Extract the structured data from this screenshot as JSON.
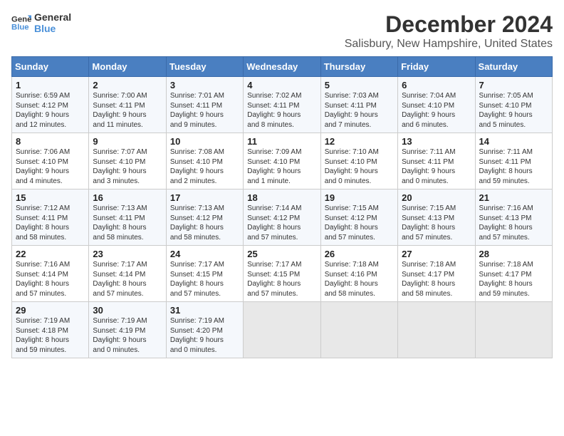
{
  "logo": {
    "line1": "General",
    "line2": "Blue"
  },
  "title": "December 2024",
  "subtitle": "Salisbury, New Hampshire, United States",
  "days_of_week": [
    "Sunday",
    "Monday",
    "Tuesday",
    "Wednesday",
    "Thursday",
    "Friday",
    "Saturday"
  ],
  "weeks": [
    [
      {
        "day": "1",
        "info": "Sunrise: 6:59 AM\nSunset: 4:12 PM\nDaylight: 9 hours\nand 12 minutes."
      },
      {
        "day": "2",
        "info": "Sunrise: 7:00 AM\nSunset: 4:11 PM\nDaylight: 9 hours\nand 11 minutes."
      },
      {
        "day": "3",
        "info": "Sunrise: 7:01 AM\nSunset: 4:11 PM\nDaylight: 9 hours\nand 9 minutes."
      },
      {
        "day": "4",
        "info": "Sunrise: 7:02 AM\nSunset: 4:11 PM\nDaylight: 9 hours\nand 8 minutes."
      },
      {
        "day": "5",
        "info": "Sunrise: 7:03 AM\nSunset: 4:11 PM\nDaylight: 9 hours\nand 7 minutes."
      },
      {
        "day": "6",
        "info": "Sunrise: 7:04 AM\nSunset: 4:10 PM\nDaylight: 9 hours\nand 6 minutes."
      },
      {
        "day": "7",
        "info": "Sunrise: 7:05 AM\nSunset: 4:10 PM\nDaylight: 9 hours\nand 5 minutes."
      }
    ],
    [
      {
        "day": "8",
        "info": "Sunrise: 7:06 AM\nSunset: 4:10 PM\nDaylight: 9 hours\nand 4 minutes."
      },
      {
        "day": "9",
        "info": "Sunrise: 7:07 AM\nSunset: 4:10 PM\nDaylight: 9 hours\nand 3 minutes."
      },
      {
        "day": "10",
        "info": "Sunrise: 7:08 AM\nSunset: 4:10 PM\nDaylight: 9 hours\nand 2 minutes."
      },
      {
        "day": "11",
        "info": "Sunrise: 7:09 AM\nSunset: 4:10 PM\nDaylight: 9 hours\nand 1 minute."
      },
      {
        "day": "12",
        "info": "Sunrise: 7:10 AM\nSunset: 4:10 PM\nDaylight: 9 hours\nand 0 minutes."
      },
      {
        "day": "13",
        "info": "Sunrise: 7:11 AM\nSunset: 4:11 PM\nDaylight: 9 hours\nand 0 minutes."
      },
      {
        "day": "14",
        "info": "Sunrise: 7:11 AM\nSunset: 4:11 PM\nDaylight: 8 hours\nand 59 minutes."
      }
    ],
    [
      {
        "day": "15",
        "info": "Sunrise: 7:12 AM\nSunset: 4:11 PM\nDaylight: 8 hours\nand 58 minutes."
      },
      {
        "day": "16",
        "info": "Sunrise: 7:13 AM\nSunset: 4:11 PM\nDaylight: 8 hours\nand 58 minutes."
      },
      {
        "day": "17",
        "info": "Sunrise: 7:13 AM\nSunset: 4:12 PM\nDaylight: 8 hours\nand 58 minutes."
      },
      {
        "day": "18",
        "info": "Sunrise: 7:14 AM\nSunset: 4:12 PM\nDaylight: 8 hours\nand 57 minutes."
      },
      {
        "day": "19",
        "info": "Sunrise: 7:15 AM\nSunset: 4:12 PM\nDaylight: 8 hours\nand 57 minutes."
      },
      {
        "day": "20",
        "info": "Sunrise: 7:15 AM\nSunset: 4:13 PM\nDaylight: 8 hours\nand 57 minutes."
      },
      {
        "day": "21",
        "info": "Sunrise: 7:16 AM\nSunset: 4:13 PM\nDaylight: 8 hours\nand 57 minutes."
      }
    ],
    [
      {
        "day": "22",
        "info": "Sunrise: 7:16 AM\nSunset: 4:14 PM\nDaylight: 8 hours\nand 57 minutes."
      },
      {
        "day": "23",
        "info": "Sunrise: 7:17 AM\nSunset: 4:14 PM\nDaylight: 8 hours\nand 57 minutes."
      },
      {
        "day": "24",
        "info": "Sunrise: 7:17 AM\nSunset: 4:15 PM\nDaylight: 8 hours\nand 57 minutes."
      },
      {
        "day": "25",
        "info": "Sunrise: 7:17 AM\nSunset: 4:15 PM\nDaylight: 8 hours\nand 57 minutes."
      },
      {
        "day": "26",
        "info": "Sunrise: 7:18 AM\nSunset: 4:16 PM\nDaylight: 8 hours\nand 58 minutes."
      },
      {
        "day": "27",
        "info": "Sunrise: 7:18 AM\nSunset: 4:17 PM\nDaylight: 8 hours\nand 58 minutes."
      },
      {
        "day": "28",
        "info": "Sunrise: 7:18 AM\nSunset: 4:17 PM\nDaylight: 8 hours\nand 59 minutes."
      }
    ],
    [
      {
        "day": "29",
        "info": "Sunrise: 7:19 AM\nSunset: 4:18 PM\nDaylight: 8 hours\nand 59 minutes."
      },
      {
        "day": "30",
        "info": "Sunrise: 7:19 AM\nSunset: 4:19 PM\nDaylight: 9 hours\nand 0 minutes."
      },
      {
        "day": "31",
        "info": "Sunrise: 7:19 AM\nSunset: 4:20 PM\nDaylight: 9 hours\nand 0 minutes."
      },
      null,
      null,
      null,
      null
    ]
  ]
}
